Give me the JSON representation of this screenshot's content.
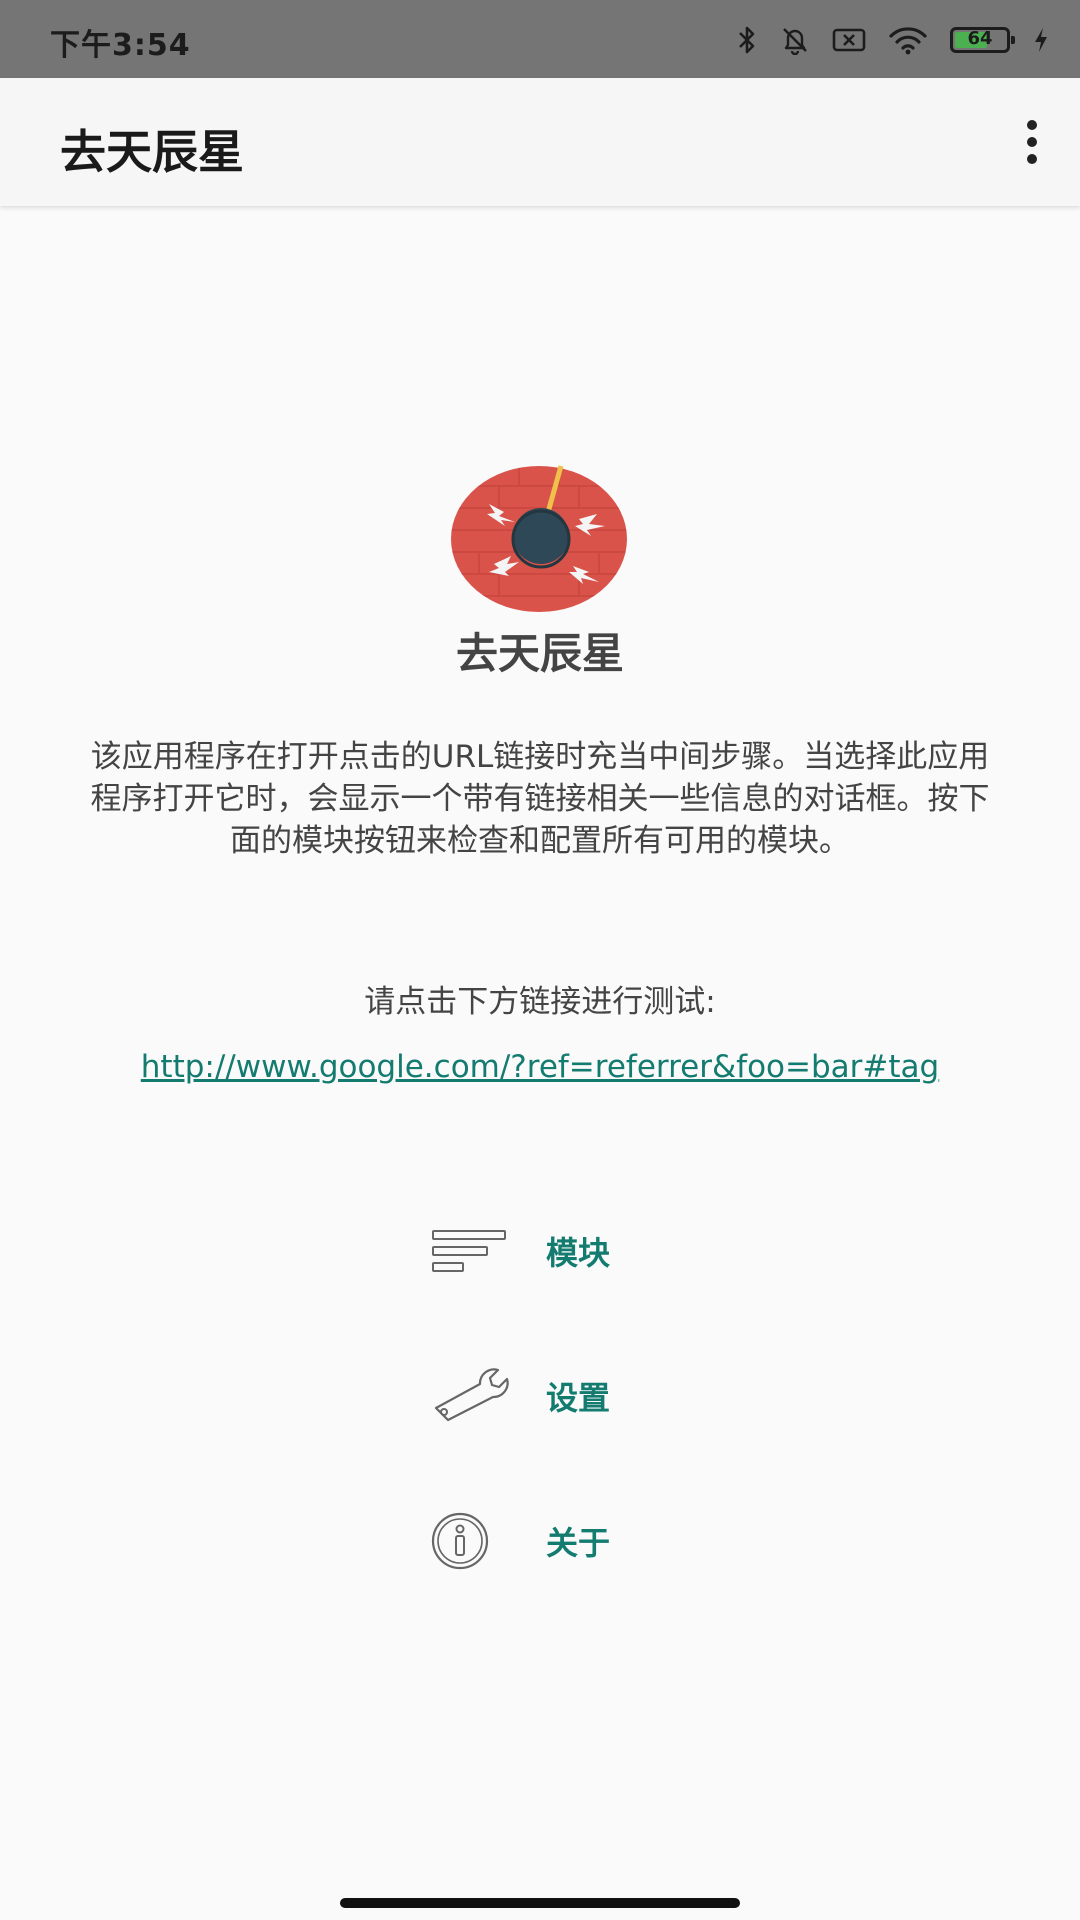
{
  "status_bar": {
    "time": "下午3:54",
    "battery_level": "64",
    "battery_fraction": 0.64
  },
  "app_bar": {
    "title": "去天辰星"
  },
  "main": {
    "app_name": "去天辰星",
    "description": "该应用程序在打开点击的URL链接时充当中间步骤。当选择此应用程序打开它时，会显示一个带有链接相关一些信息的对话框。按下面的模块按钮来检查和配置所有可用的模块。",
    "test_prompt": "请点击下方链接进行测试:",
    "test_link": "http://www.google.com/?ref=referrer&foo=bar#tag"
  },
  "menu": [
    {
      "label": "模块",
      "icon": "list-icon"
    },
    {
      "label": "设置",
      "icon": "wrench-icon"
    },
    {
      "label": "关于",
      "icon": "info-icon"
    }
  ],
  "colors": {
    "accent": "#137b6f",
    "logo_red": "#d9534a",
    "logo_dark": "#2f4858",
    "status_bar_bg": "#757575"
  }
}
